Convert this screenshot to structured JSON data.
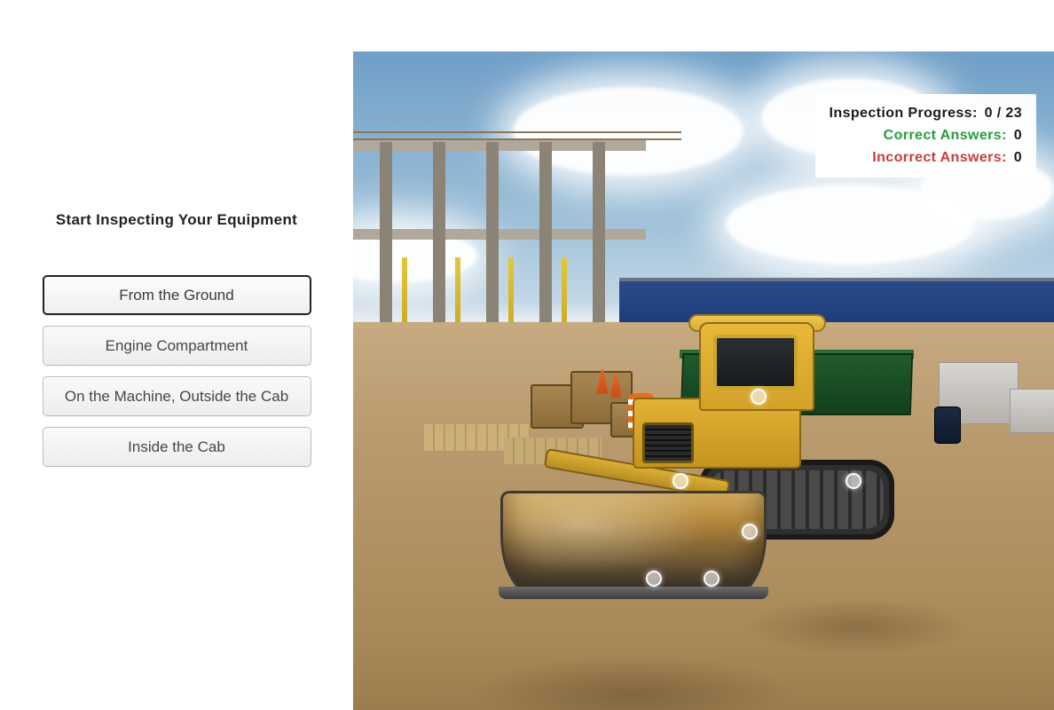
{
  "panel": {
    "title": "Start Inspecting Your Equipment",
    "options": [
      {
        "label": "From the Ground",
        "selected": true
      },
      {
        "label": "Engine Compartment",
        "selected": false
      },
      {
        "label": "On the Machine, Outside the Cab",
        "selected": false
      },
      {
        "label": "Inside the Cab",
        "selected": false
      }
    ]
  },
  "stats": {
    "progress_label": "Inspection Progress:",
    "progress_value": "0 / 23",
    "correct_label": "Correct Answers:",
    "correct_value": "0",
    "incorrect_label": "Incorrect Answers:",
    "incorrect_value": "0"
  }
}
